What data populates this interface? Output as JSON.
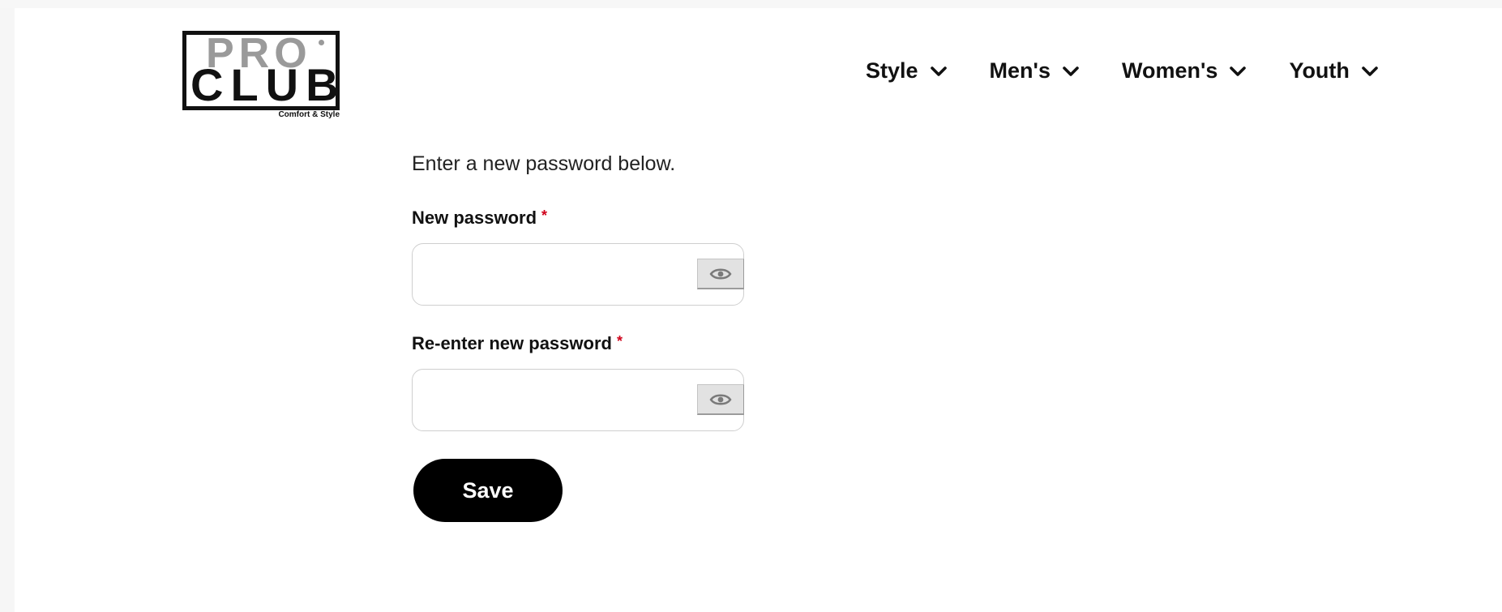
{
  "brand": {
    "logo_top": "PRO",
    "logo_bottom": "CLUB",
    "tagline": "Comfort & Style"
  },
  "nav": {
    "items": [
      {
        "label": "Style",
        "icon": "chevron-down-icon"
      },
      {
        "label": "Men's",
        "icon": "chevron-down-icon"
      },
      {
        "label": "Women's",
        "icon": "chevron-down-icon"
      },
      {
        "label": "Youth",
        "icon": "chevron-down-icon"
      }
    ]
  },
  "form": {
    "intro": "Enter a new password below.",
    "new_password": {
      "label": "New password",
      "required_marker": "*",
      "value": "",
      "toggle_icon": "eye-icon"
    },
    "confirm_password": {
      "label": "Re-enter new password",
      "required_marker": "*",
      "value": "",
      "toggle_icon": "eye-icon"
    },
    "save_label": "Save"
  },
  "colors": {
    "required": "#d0021b",
    "button_bg": "#000000",
    "button_text": "#ffffff",
    "logo_grey": "#9a9a9a"
  }
}
